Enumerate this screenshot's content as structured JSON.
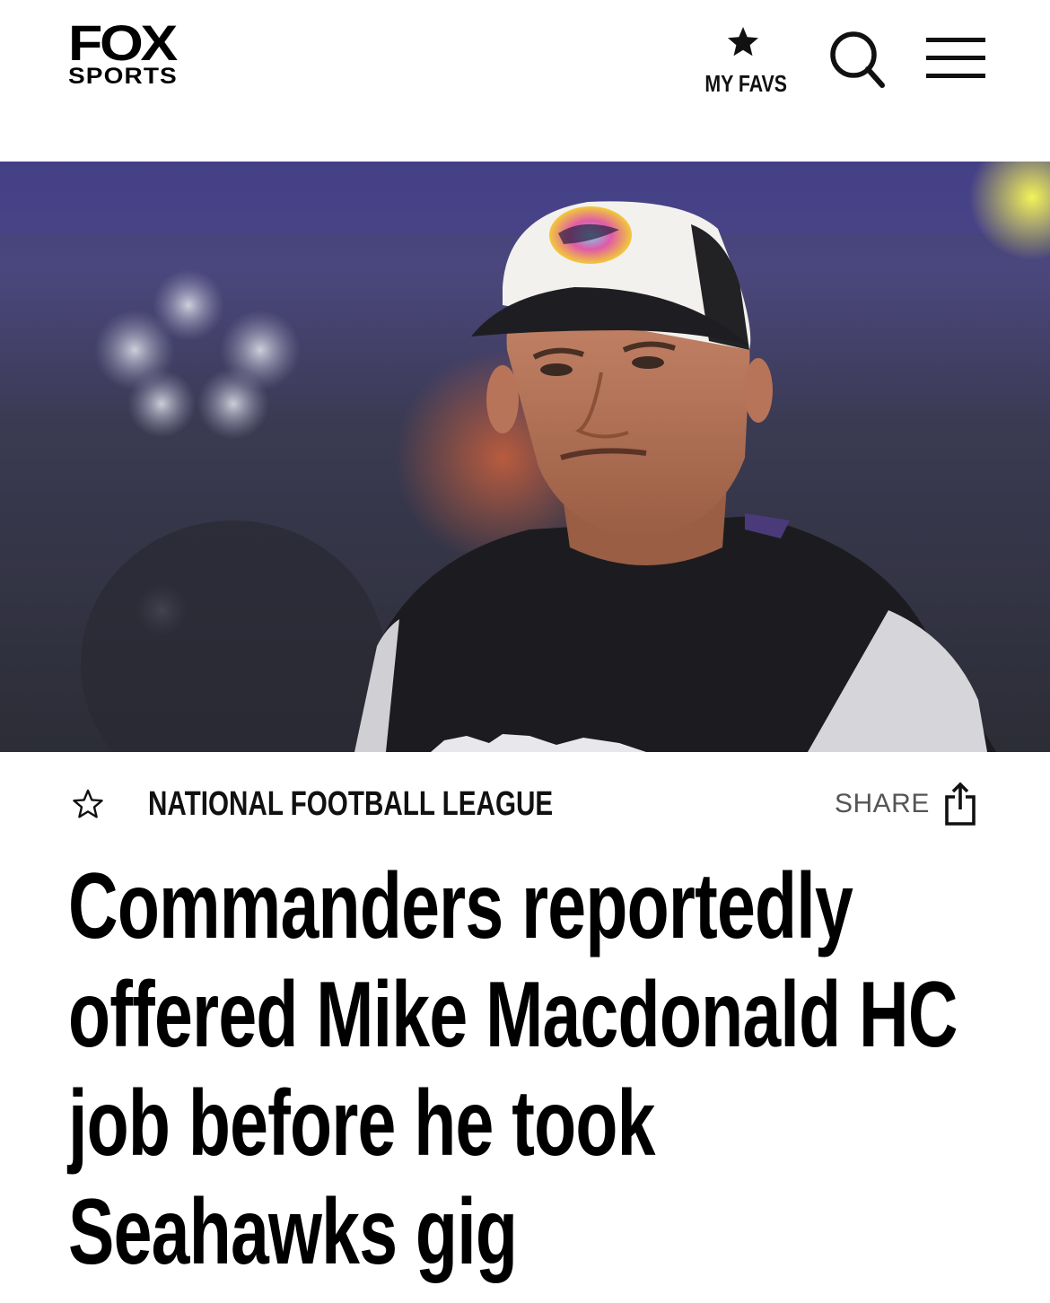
{
  "header": {
    "logo_line1": "FOX",
    "logo_line2": "SPORTS",
    "favs_label": "MY FAVS",
    "icons": [
      "star-icon",
      "search-icon",
      "hamburger-menu-icon"
    ]
  },
  "article": {
    "category": "NATIONAL FOOTBALL LEAGUE",
    "share_label": "SHARE",
    "headline": "Commanders reportedly offered Mike Macdonald HC job before he took Seahawks gig",
    "icons": [
      "star-outline-icon",
      "share-icon"
    ]
  },
  "colors": {
    "text": "#000000",
    "share_text": "#555555",
    "background": "#ffffff"
  }
}
